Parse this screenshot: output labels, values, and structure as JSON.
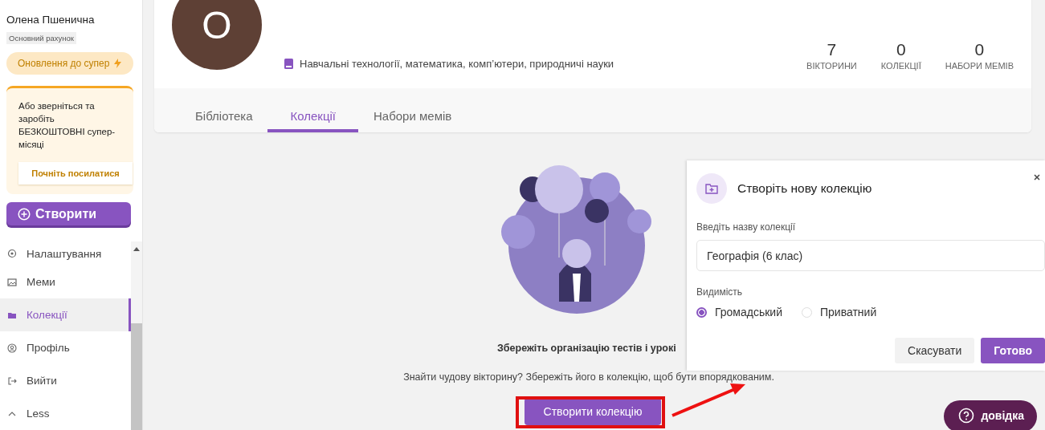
{
  "sidebar": {
    "user_name": "Олена Пшенична",
    "account_badge": "Основний рахунок",
    "upgrade_button": "Оновлення до супер",
    "referral": {
      "text": "Або зверніться та заробіть БЕЗКОШТОВНІ супер-місяці",
      "button": "Почніть посилатися"
    },
    "create_button": "Створити",
    "items": [
      {
        "kind": "settings",
        "label": "Налаштування",
        "selected": false
      },
      {
        "kind": "memes",
        "label": "Меми",
        "selected": false
      },
      {
        "kind": "collections",
        "label": "Колекції",
        "selected": true
      },
      {
        "kind": "profile",
        "label": "Профіль",
        "selected": false
      },
      {
        "kind": "logout",
        "label": "Вийти",
        "selected": false
      },
      {
        "kind": "less",
        "label": "Less",
        "selected": false
      }
    ]
  },
  "profile": {
    "avatar_letter": "O",
    "subjects": "Навчальні технології, математика, комп’ютери, природничі науки",
    "stats": [
      {
        "value": "7",
        "label": "ВІКТОРИНИ"
      },
      {
        "value": "0",
        "label": "КОЛЕКЦІЇ"
      },
      {
        "value": "0",
        "label": "НАБОРИ МЕМІВ"
      }
    ]
  },
  "tabs": [
    {
      "label": "Бібліотека",
      "selected": false
    },
    {
      "label": "Колекції",
      "selected": true
    },
    {
      "label": "Набори мемів",
      "selected": false
    }
  ],
  "empty_state": {
    "heading": "Збережіть організацію тестів і урокі",
    "text": "Знайти чудову вікторину? Збережіть його в колекцію, щоб бути впорядкованим.",
    "button": "Створити колекцію"
  },
  "dialog": {
    "title": "Створіть нову колекцію",
    "name_label": "Введіть назву колекції",
    "name_value": "Географія (6 клас)",
    "visibility_label": "Видимість",
    "options": [
      {
        "label": "Громадський",
        "selected": true
      },
      {
        "label": "Приватний",
        "selected": false
      }
    ],
    "cancel": "Скасувати",
    "confirm": "Готово"
  },
  "help_button": "довідка"
}
